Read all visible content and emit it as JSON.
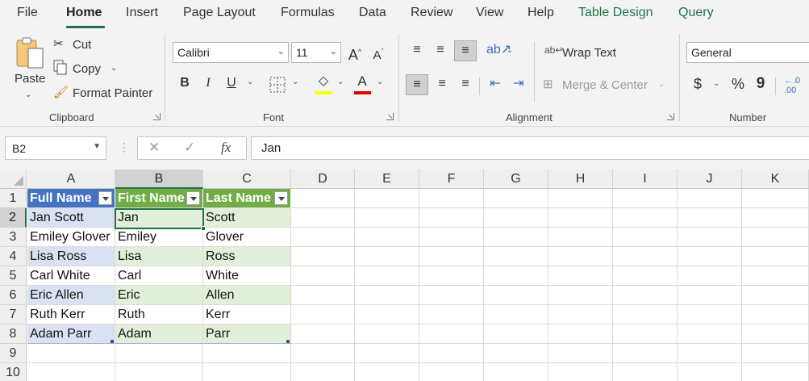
{
  "tabs": [
    {
      "label": "File"
    },
    {
      "label": "Home"
    },
    {
      "label": "Insert"
    },
    {
      "label": "Page Layout"
    },
    {
      "label": "Formulas"
    },
    {
      "label": "Data"
    },
    {
      "label": "Review"
    },
    {
      "label": "View"
    },
    {
      "label": "Help"
    },
    {
      "label": "Table Design"
    },
    {
      "label": "Query"
    }
  ],
  "clipboard": {
    "paste": "Paste",
    "cut": "Cut",
    "copy": "Copy",
    "format_painter": "Format Painter",
    "group": "Clipboard"
  },
  "font": {
    "name": "Calibri",
    "size": "11",
    "group": "Font",
    "bold": "B",
    "italic": "I",
    "underline": "U",
    "grow": "A",
    "shrink": "A",
    "font_color_letter": "A",
    "font_color": "#e00000",
    "highlight_color": "#ffff00"
  },
  "alignment": {
    "wrap_text": "Wrap Text",
    "merge_center": "Merge & Center",
    "group": "Alignment"
  },
  "number": {
    "format": "General",
    "currency": "$",
    "percent": "%",
    "comma": "9",
    "group": "Number"
  },
  "formula_bar": {
    "name_box": "B2",
    "fx": "fx",
    "content": "Jan"
  },
  "grid": {
    "columns": [
      "A",
      "B",
      "C",
      "D",
      "E",
      "F",
      "G",
      "H",
      "I",
      "J",
      "K"
    ],
    "rows": [
      "1",
      "2",
      "3",
      "4",
      "5",
      "6",
      "7",
      "8",
      "9",
      "10"
    ],
    "selected_column": "B",
    "selected_row": "2",
    "header": [
      "Full Name",
      "First Name",
      "Last Name"
    ],
    "data": [
      [
        "Jan Scott",
        "Jan",
        "Scott"
      ],
      [
        "Emiley Glover",
        "Emiley",
        "Glover"
      ],
      [
        "Lisa Ross",
        "Lisa",
        "Ross"
      ],
      [
        "Carl White",
        "Carl",
        "White"
      ],
      [
        "Eric Allen",
        "Eric",
        "Allen"
      ],
      [
        "Ruth Kerr",
        "Ruth",
        "Kerr"
      ],
      [
        "Adam Parr",
        "Adam",
        "Parr"
      ]
    ]
  },
  "colors": {
    "accent": "#217346",
    "table_blue_header": "#4472c4",
    "table_blue_band": "#d9e1f2",
    "table_green_header": "#70ad47",
    "table_green_band": "#e2efda"
  }
}
